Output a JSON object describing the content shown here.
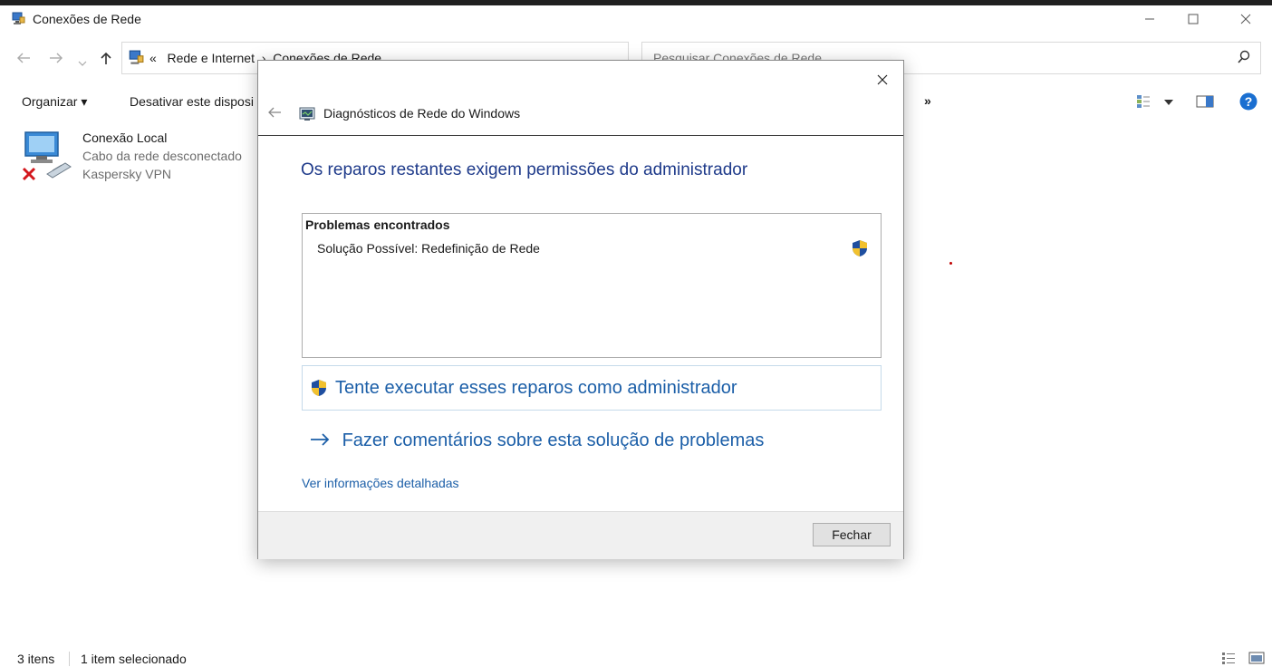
{
  "window": {
    "title": "Conexões de Rede"
  },
  "address": {
    "crumb_sep": "«",
    "crumb1": "Rede e Internet",
    "crumb_arrow": "›",
    "crumb2": "Conexões de Rede"
  },
  "search": {
    "placeholder": "Pesquisar Conexões de Rede"
  },
  "toolbar": {
    "organize_label": "Organizar ▾",
    "disable_label": "Desativar este disposi",
    "more_label": "»"
  },
  "connection": {
    "name": "Conexão Local",
    "status": "Cabo da rede desconectado",
    "adapter": "Kaspersky VPN"
  },
  "statusbar": {
    "items_count": "3 itens",
    "selected": "1 item selecionado"
  },
  "dialog": {
    "title": "Diagnósticos de Rede do Windows",
    "heading": "Os reparos restantes exigem permissões do administrador",
    "problems_header": "Problemas encontrados",
    "problem_1": "Solução Possível: Redefinição de Rede",
    "admin_link": "Tente executar esses reparos como administrador",
    "feedback_link": "Fazer comentários sobre esta solução de problemas",
    "details_link": "Ver informações detalhadas",
    "close_label": "Fechar",
    "back_icon": "back-arrow-icon",
    "close_icon": "close-icon"
  },
  "colors": {
    "link_blue": "#1c5fa8",
    "heading_blue": "#1e3a8a",
    "footer_gray": "#f0f0f0"
  }
}
